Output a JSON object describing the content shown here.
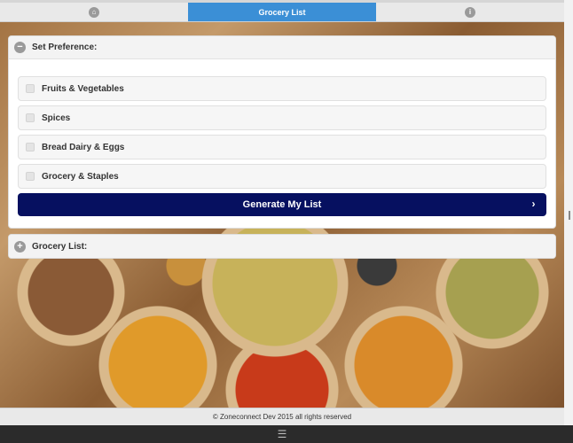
{
  "topnav": {
    "home_icon": "home-icon",
    "center_title": "Grocery List",
    "info_icon": "info-icon"
  },
  "preference": {
    "title": "Set Preference:",
    "options": [
      {
        "label": "Fruits & Vegetables",
        "checked": false
      },
      {
        "label": "Spices",
        "checked": false
      },
      {
        "label": "Bread Dairy & Eggs",
        "checked": false
      },
      {
        "label": "Grocery & Staples",
        "checked": false
      }
    ],
    "generate_label": "Generate My List"
  },
  "grocery": {
    "title": "Grocery List:"
  },
  "footer": {
    "text": "© Zoneconnect Dev 2015 all rights reserved"
  },
  "colors": {
    "accent": "#3b8fd6",
    "button": "#061060"
  }
}
